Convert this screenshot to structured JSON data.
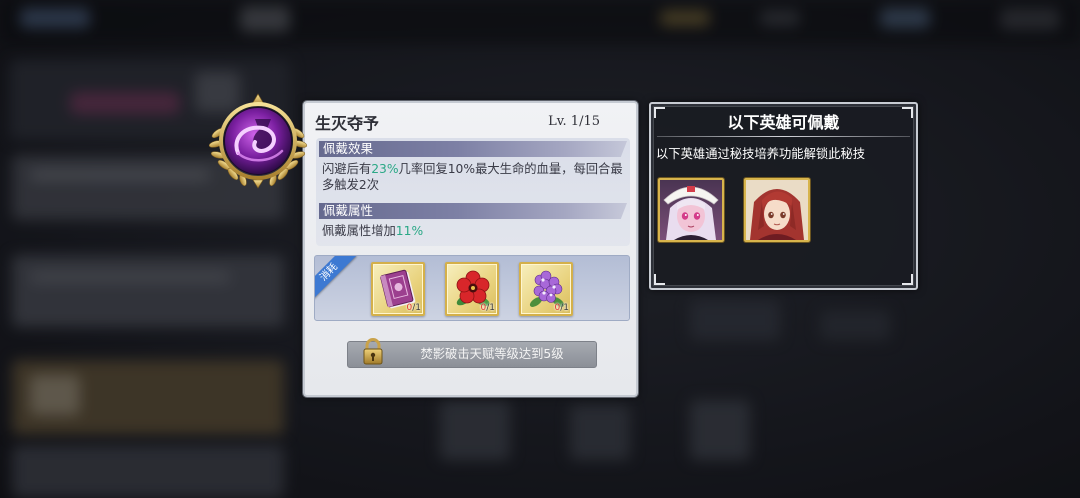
{
  "skill": {
    "name": "生灭夺予",
    "level": "Lv. 1/15",
    "emblem_icon": "purple-swirl-emblem-icon"
  },
  "effect": {
    "header": "佩戴效果",
    "line1": {
      "before": "闪避后有",
      "highlight": "23%",
      "after": "几率回复10%最大生命的血量，每回合最"
    },
    "line2": "多触发2次"
  },
  "attribute": {
    "header": "佩戴属性",
    "text": "佩戴属性增加",
    "highlight": "11%"
  },
  "consume": {
    "ribbon": "消耗",
    "items": [
      {
        "icon": "purple-book-icon",
        "have": "0",
        "need": "/1"
      },
      {
        "icon": "red-flower-icon",
        "have": "0",
        "need": "/1"
      },
      {
        "icon": "purple-flower-icon",
        "have": "0",
        "need": "/1"
      }
    ]
  },
  "unlock": {
    "icon": "lock-icon",
    "label": "焚影破击天赋等级达到5级"
  },
  "heroes_panel": {
    "title": "以下英雄可佩戴",
    "subtitle": "以下英雄通过秘技培养功能解锁此秘技",
    "heroes": [
      {
        "icon": "white-haired-hero-portrait"
      },
      {
        "icon": "red-haired-hero-portrait"
      }
    ]
  },
  "colors": {
    "highlight": "#2aa886",
    "count_missing": "#e2332f",
    "ribbon": "#3d79d2",
    "frame_gold": "#d4b04a"
  }
}
